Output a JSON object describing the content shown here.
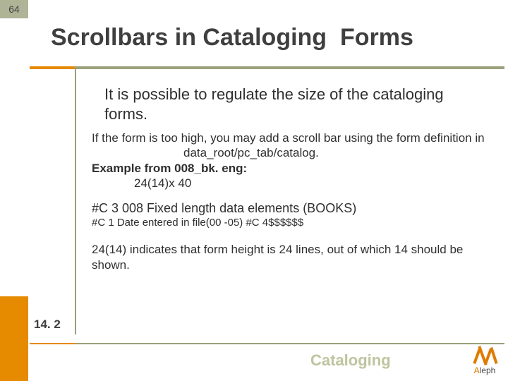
{
  "page_number": "64",
  "title": "Scrollbars in Cataloging  Forms",
  "body": {
    "intro": "It is possible to regulate the size of the cataloging forms.",
    "para1": "If the form is too high, you may add a scroll bar using the form definition in",
    "path": "data_root/pc_tab/catalog.",
    "example_label": "Example from 008_bk. eng:",
    "example_value": "24(14)x 40",
    "line_c3": "#C 3 008 Fixed length data elements (BOOKS)",
    "line_c1": "#C 1 Date entered in file(00 -05) #C 4$$$$$$",
    "explain": "24(14) indicates that form height is 24 lines, out of which 14 should be shown."
  },
  "version": "14. 2",
  "footer_label": "Cataloging",
  "logo": {
    "word_prefix": "A",
    "word_rest": "leph"
  },
  "colors": {
    "accent": "#e68a00",
    "olive": "#9aa07a",
    "badge_bg": "#b0b497"
  }
}
